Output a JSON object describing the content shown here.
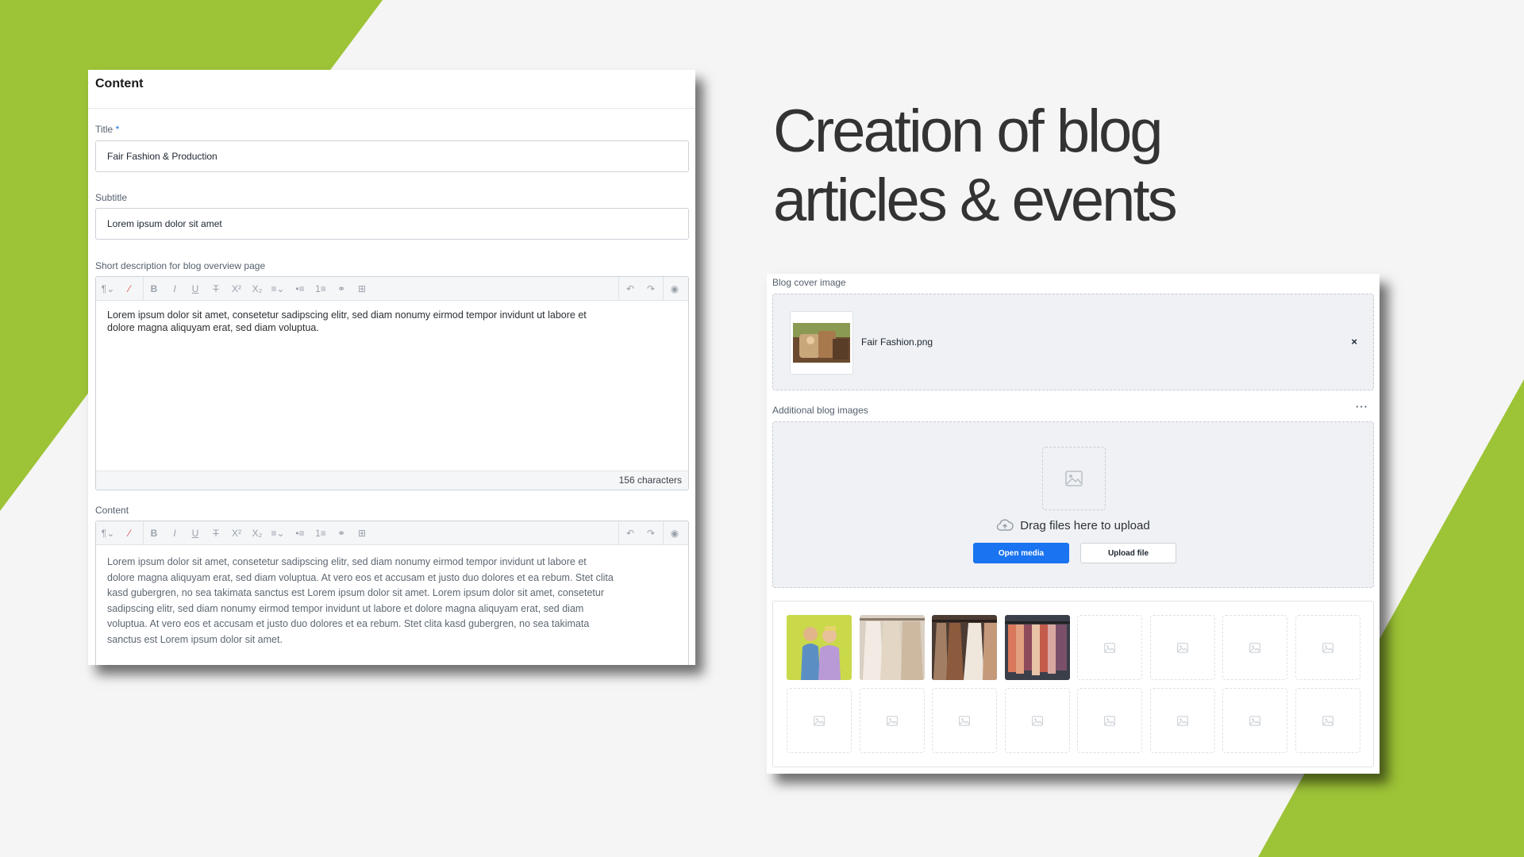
{
  "content_card": {
    "title": "Content",
    "title_label": "Title",
    "required_mark": "*",
    "title_value": "Fair Fashion & Production",
    "subtitle_label": "Subtitle",
    "subtitle_value": "Lorem ipsum dolor sit amet",
    "short_desc_label": "Short description for blog overview page",
    "short_desc_lines": [
      "Lorem ipsum dolor sit amet, consetetur sadipscing elitr, sed diam nonumy eirmod tempor invidunt ut labore et",
      "dolore magna aliquyam erat, sed diam voluptua."
    ],
    "char_count": "156 characters",
    "content_label": "Content",
    "content_lines": [
      "Lorem ipsum dolor sit amet, consetetur sadipscing elitr, sed diam nonumy eirmod tempor invidunt ut labore et",
      "dolore magna aliquyam erat, sed diam voluptua. At vero eos et accusam et justo duo dolores et ea rebum. Stet clita",
      "kasd gubergren, no sea takimata sanctus est Lorem ipsum dolor sit amet. Lorem ipsum dolor sit amet, consetetur",
      "sadipscing elitr, sed diam nonumy eirmod tempor invidunt ut labore et dolore magna aliquyam erat, sed diam",
      "voluptua. At vero eos et accusam et justo duo dolores et ea rebum. Stet clita kasd gubergren, no sea takimata",
      "sanctus est Lorem ipsum dolor sit amet."
    ],
    "toolbar_icons": [
      "paragraph-icon",
      "clear-format-icon",
      "bold-icon",
      "italic-icon",
      "underline-icon",
      "strikethrough-icon",
      "superscript-icon",
      "subscript-icon",
      "align-icon",
      "bullet-list-icon",
      "numbered-list-icon",
      "link-icon",
      "table-icon",
      "undo-icon",
      "redo-icon",
      "code-view-icon"
    ]
  },
  "heading": {
    "line1": "Creation of blog",
    "line2": "articles & events"
  },
  "media_card": {
    "cover_label": "Blog cover image",
    "cover_filename": "Fair Fashion.png",
    "close_symbol": "×",
    "additional_label": "Additional blog images",
    "more_symbol": "···",
    "drop_text": "Drag files here to upload",
    "open_media_label": "Open media",
    "upload_file_label": "Upload file",
    "gallery_filled": 4,
    "gallery_total": 16
  },
  "colors": {
    "accent_green": "#9dc336",
    "primary_blue": "#1a73f0",
    "heading_gray": "#333333"
  }
}
